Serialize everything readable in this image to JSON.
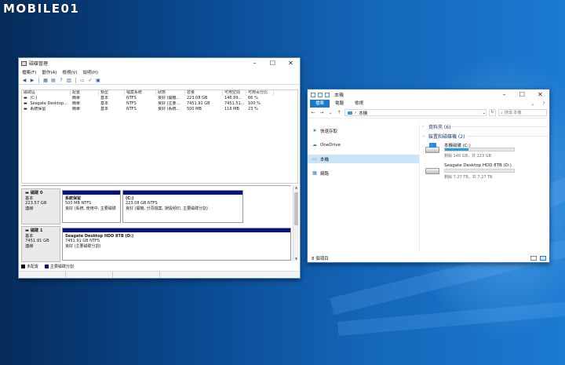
{
  "watermark": "MOBILE01",
  "disk_mgmt": {
    "title": "磁碟管理",
    "window_controls": [
      "–",
      "☐",
      "✕"
    ],
    "menu": [
      "檔案(F)",
      "動作(A)",
      "檢視(V)",
      "說明(H)"
    ],
    "table": {
      "headers": [
        "磁碟區",
        "配置",
        "類型",
        "檔案系統",
        "狀態",
        "容量",
        "可用空間",
        "可用百分比"
      ],
      "rows": [
        [
          "(C:)",
          "簡單",
          "基本",
          "NTFS",
          "良好 (開機...",
          "223.08 GB",
          "146.99...",
          "66 %"
        ],
        [
          "Seagate Desktop...",
          "簡單",
          "基本",
          "NTFS",
          "良好 (主要...",
          "7451.91 GB",
          "7451.51...",
          "100 %"
        ],
        [
          "系統保留",
          "簡單",
          "基本",
          "NTFS",
          "良好 (系統...",
          "500 MB",
          "116 MB",
          "23 %"
        ]
      ]
    },
    "disks": [
      {
        "name": "磁碟 0",
        "type": "基本",
        "size": "223.57 GB",
        "status": "連線",
        "partitions": [
          {
            "name": "系統保留",
            "size": "500 MB NTFS",
            "status": "良好 (系統, 使用中, 主要磁碟"
          },
          {
            "name": "(C:)",
            "size": "223.08 GB NTFS",
            "status": "良好 (開機, 分頁檔案, 損毀傾印, 主要磁碟分割)"
          }
        ]
      },
      {
        "name": "磁碟 1",
        "type": "基本",
        "size": "7451.91 GB",
        "status": "連線",
        "partitions": [
          {
            "name": "Seagate Desktop HDD 8TB (D:)",
            "size": "7451.91 GB NTFS",
            "status": "良好 (主要磁碟分割)"
          }
        ]
      }
    ],
    "legend": [
      {
        "label": "未配置",
        "color": "#000000"
      },
      {
        "label": "主要磁碟分割",
        "color": "#04117a"
      }
    ]
  },
  "explorer": {
    "title": "本機",
    "window_controls": [
      "–",
      "☐",
      "✕"
    ],
    "ribbon_tabs": [
      "檔案",
      "電腦",
      "檢視"
    ],
    "address": "本機",
    "search_placeholder": "搜尋 本機",
    "nav": [
      {
        "label": "快速存取",
        "icon": "star-icon"
      },
      {
        "label": "OneDrive",
        "icon": "cloud-icon"
      },
      {
        "label": "本機",
        "icon": "computer-icon"
      },
      {
        "label": "網路",
        "icon": "network-icon"
      }
    ],
    "groups": {
      "folders": "資料夾 (6)",
      "devices": "裝置和磁碟機 (2)"
    },
    "drives": [
      {
        "name": "本機磁碟 (C:)",
        "free_text": "剩餘 146 GB，共 223 GB",
        "used_fraction": 0.34
      },
      {
        "name": "Seagate Desktop HDD 8TB (D:)",
        "free_text": "剩餘 7.27 TB，共 7.27 TB",
        "used_fraction": 0.0
      }
    ],
    "status": "8 個項目"
  }
}
